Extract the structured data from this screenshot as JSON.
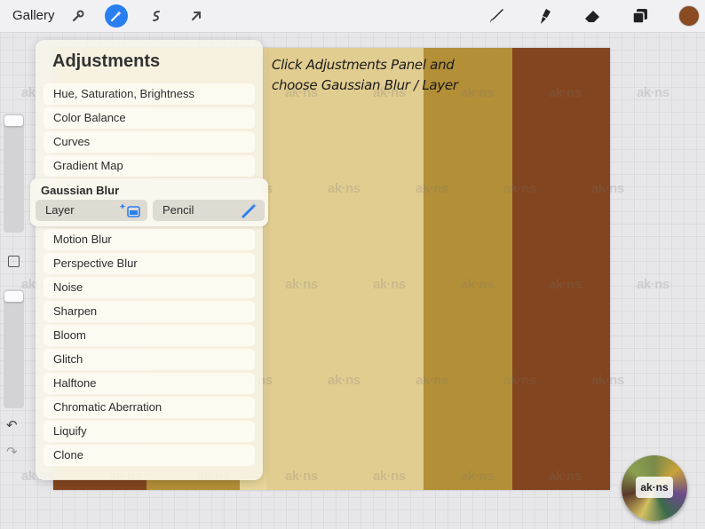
{
  "topbar": {
    "gallery_label": "Gallery",
    "tools": [
      "wrench-icon",
      "magic-wand-icon",
      "selection-icon",
      "transform-arrow-icon"
    ],
    "right_tools": [
      "brush-icon",
      "smudge-icon",
      "eraser-icon",
      "layers-icon"
    ],
    "current_color": "#8a4a22"
  },
  "canvas": {
    "stripes": [
      "#ecdda7",
      "#e7d69a",
      "#e1cd90",
      "#b38f37",
      "#83451f"
    ],
    "bottom_stripes": [
      "#83451f",
      "#b38f37"
    ]
  },
  "instruction": {
    "line1": "Click Adjustments Panel and",
    "line2": "choose Gaussian Blur / Layer"
  },
  "adjustments": {
    "title": "Adjustments",
    "items_top": [
      "Hue, Saturation, Brightness",
      "Color Balance",
      "Curves",
      "Gradient Map"
    ],
    "gaussian": {
      "title": "Gaussian Blur",
      "layer_label": "Layer",
      "pencil_label": "Pencil"
    },
    "items_bottom": [
      "Motion Blur",
      "Perspective Blur",
      "Noise",
      "Sharpen",
      "Bloom",
      "Glitch",
      "Halftone",
      "Chromatic Aberration",
      "Liquify",
      "Clone"
    ]
  },
  "watermark_text": "ak·ns",
  "reference_badge": "ak·ns"
}
